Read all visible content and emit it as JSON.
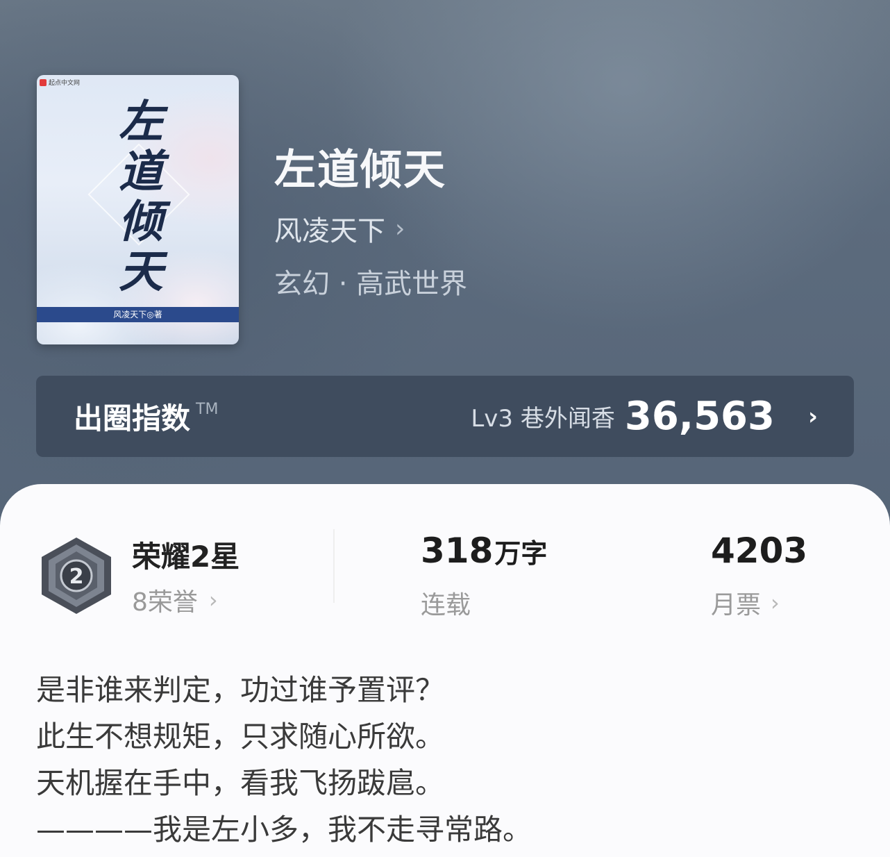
{
  "book": {
    "cover": {
      "logo_text": "起点中文网",
      "title_chars": [
        "左",
        "道",
        "倾",
        "天"
      ],
      "band_text": "风凌天下◎著"
    },
    "title": "左道倾天",
    "author": "风凌天下",
    "genre": "玄幻 · 高武世界"
  },
  "index_bar": {
    "label": "出圈指数",
    "tm": "TM",
    "level": "Lv3 巷外闻香",
    "value": "36,563"
  },
  "stats": {
    "honor": {
      "badge_number": "2",
      "title": "荣耀2星",
      "sub": "8荣誉"
    },
    "words": {
      "value": "318",
      "unit": "万字",
      "label": "连载"
    },
    "tickets": {
      "value": "4203",
      "label": "月票"
    }
  },
  "blurb": [
    "是非谁来判定，功过谁予置评？",
    "此生不想规矩，只求随心所欲。",
    "天机握在手中，看我飞扬跋扈。",
    "————我是左小多，我不走寻常路。"
  ],
  "colors": {
    "panel": "#fbfbfd",
    "hero": "#5c6b7d",
    "index_bar": "#3f4c5e"
  }
}
